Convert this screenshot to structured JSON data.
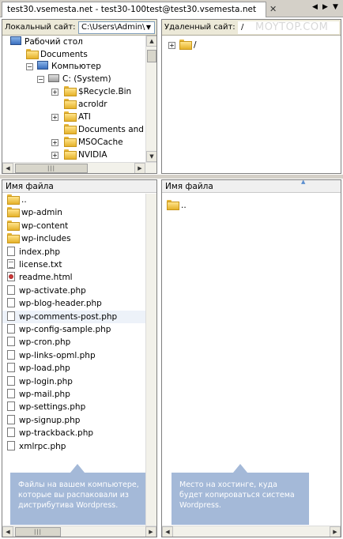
{
  "tab": {
    "title": "test30.vsemesta.net - test30-100test@test30.vsemesta.net",
    "close": "✕"
  },
  "tab_nav": {
    "left": "◀",
    "right": "▶",
    "menu": "▼"
  },
  "local": {
    "label": "Локальный сайт:",
    "path": "C:\\Users\\Admin\\",
    "tree": [
      {
        "label": "Рабочий стол",
        "icon": "desktop-icon"
      },
      {
        "label": "Documents",
        "icon": "folder-icon"
      },
      {
        "label": "Компьютер",
        "icon": "computer-icon"
      },
      {
        "label": "C: (System)",
        "icon": "drive-icon"
      },
      {
        "label": "$Recycle.Bin",
        "icon": "folder-icon"
      },
      {
        "label": "acroldr",
        "icon": "folder-icon"
      },
      {
        "label": "ATI",
        "icon": "folder-icon"
      },
      {
        "label": "Documents and S",
        "icon": "folder-icon"
      },
      {
        "label": "MSOCache",
        "icon": "folder-icon"
      },
      {
        "label": "NVIDIA",
        "icon": "folder-icon"
      }
    ],
    "column_header": "Имя файла",
    "files": [
      {
        "name": "..",
        "type": "folder"
      },
      {
        "name": "wp-admin",
        "type": "folder"
      },
      {
        "name": "wp-content",
        "type": "folder"
      },
      {
        "name": "wp-includes",
        "type": "folder"
      },
      {
        "name": "index.php",
        "type": "doc"
      },
      {
        "name": "license.txt",
        "type": "txt"
      },
      {
        "name": "readme.html",
        "type": "html"
      },
      {
        "name": "wp-activate.php",
        "type": "doc"
      },
      {
        "name": "wp-blog-header.php",
        "type": "doc"
      },
      {
        "name": "wp-comments-post.php",
        "type": "doc"
      },
      {
        "name": "wp-config-sample.php",
        "type": "doc"
      },
      {
        "name": "wp-cron.php",
        "type": "doc"
      },
      {
        "name": "wp-links-opml.php",
        "type": "doc"
      },
      {
        "name": "wp-load.php",
        "type": "doc"
      },
      {
        "name": "wp-login.php",
        "type": "doc"
      },
      {
        "name": "wp-mail.php",
        "type": "doc"
      },
      {
        "name": "wp-settings.php",
        "type": "doc"
      },
      {
        "name": "wp-signup.php",
        "type": "doc"
      },
      {
        "name": "wp-trackback.php",
        "type": "doc"
      },
      {
        "name": "xmlrpc.php",
        "type": "doc"
      }
    ],
    "callout": "Файлы на вашем компьютере, которые вы распаковали из дистрибутива Wordpress."
  },
  "remote": {
    "label": "Удаленный сайт:",
    "path": "/",
    "watermark": "MOYTOP.COM",
    "tree": [
      {
        "label": "/",
        "icon": "folder-icon"
      }
    ],
    "column_header": "Имя файла",
    "files": [
      {
        "name": "..",
        "type": "folder"
      }
    ],
    "callout": "Место на хостинге, куда будет копироваться система Wordpress."
  },
  "scroll_glyphs": {
    "up": "▲",
    "down": "▼",
    "left": "◀",
    "right": "▶",
    "grip": "|||"
  }
}
